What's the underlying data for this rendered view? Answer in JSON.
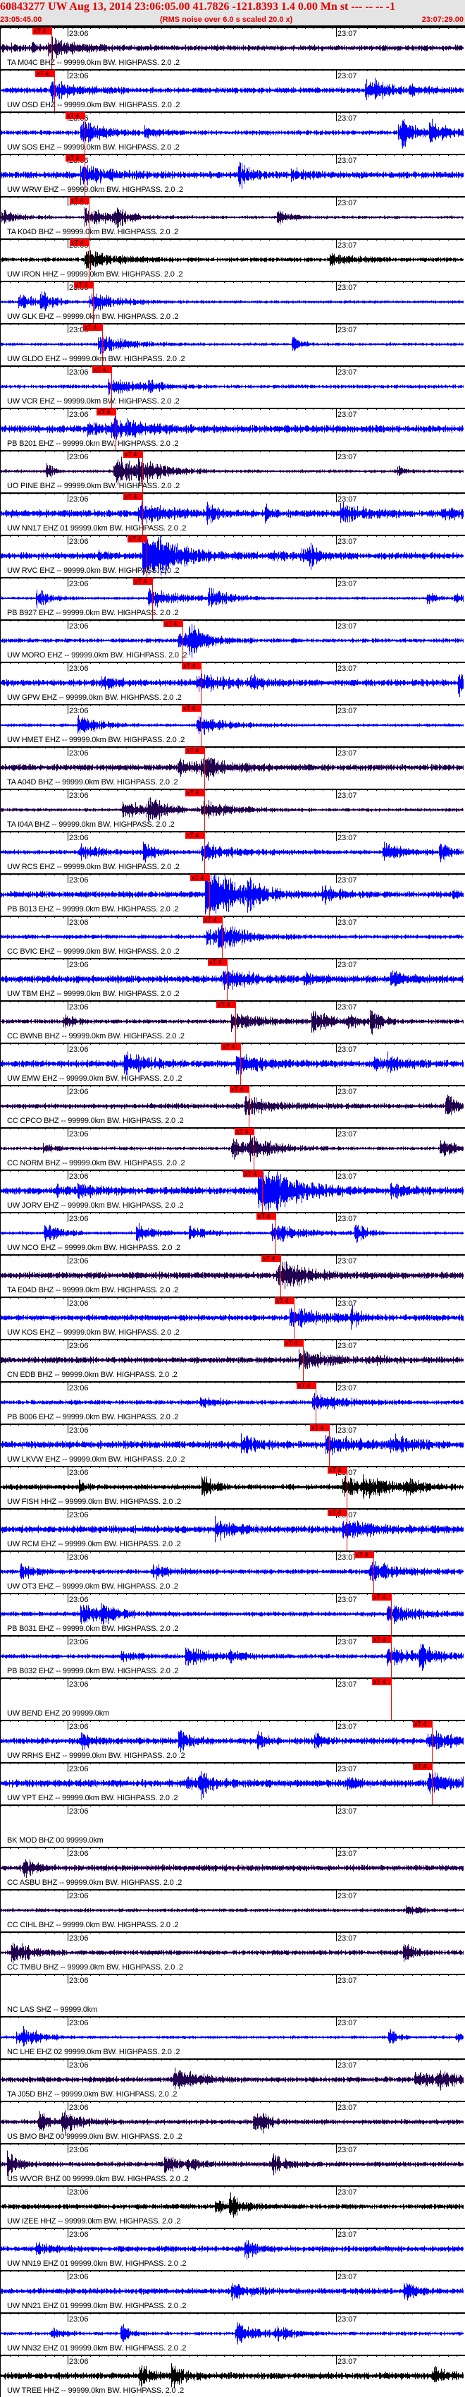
{
  "header": {
    "title": "60843277 UW Aug 13, 2014 23:06:05.00    41.7826 -121.8393  1.4 0.00 Mn st --- -- --   -1",
    "start_time": "23:05:45.00",
    "note": "(RMS noise over 6.0 s scaled 20.0 x)",
    "end_time": "23:07:29.00"
  },
  "axis": {
    "window_seconds": 104,
    "minute_labels": [
      {
        "label": "23:06",
        "t": 15
      },
      {
        "label": "23:07",
        "t": 75
      }
    ]
  },
  "pick_label": "xT 4",
  "colors": {
    "bhz": "#220050",
    "ehz": "#0000ff",
    "hhz": "#000000",
    "pick": "#ff0000",
    "header_text": "#e00000"
  },
  "traces": [
    {
      "label": "TA M04C BHZ -- 99999.0km BW. HIGHPASS. 2.0 .2",
      "color": "bhz",
      "pick_s": 11.4
    },
    {
      "label": "UW OSD EHZ -- 99999.0km BW. HIGHPASS. 2.0 .2",
      "color": "ehz",
      "pick_s": 11.9
    },
    {
      "label": "UW SOS EHZ -- 99999.0km BW. HIGHPASS. 2.0 .2",
      "color": "ehz",
      "pick_s": 18.8
    },
    {
      "label": "UW WRW EHZ -- 99999.0km BW. HIGHPASS. 2.0 .2",
      "color": "ehz",
      "pick_s": 18.8
    },
    {
      "label": "TA K04D BHZ -- 99999.0km BW. HIGHPASS. 2.0 .2",
      "color": "bhz",
      "pick_s": 19.7
    },
    {
      "label": "UW IRON HHZ -- 99999.0km BW. HIGHPASS. 2.0 .2",
      "color": "hhz",
      "pick_s": 19.7
    },
    {
      "label": "UW GLK EHZ -- 99999.0km BW. HIGHPASS. 2.0 .2",
      "color": "ehz",
      "pick_s": 20.7
    },
    {
      "label": "UW GLDO EHZ -- 99999.0km BW. HIGHPASS. 2.0 .2",
      "color": "ehz",
      "pick_s": 22.7
    },
    {
      "label": "UW VCR EHZ -- 99999.0km BW. HIGHPASS. 2.0 .2",
      "color": "ehz",
      "pick_s": 24.8
    },
    {
      "label": "PB B201 EHZ -- 99999.0km BW. HIGHPASS. 2.0 .2",
      "color": "ehz",
      "pick_s": 25.7
    },
    {
      "label": "UO PINE BHZ -- 99999.0km BW. HIGHPASS. 2.0 .2",
      "color": "bhz",
      "pick_s": 31.7
    },
    {
      "label": "UW NN17 EHZ 01 99999.0km BW. HIGHPASS. 2.0 .2",
      "color": "ehz",
      "pick_s": 31.7
    },
    {
      "label": "UW RVC EHZ -- 99999.0km BW. HIGHPASS. 2.0 .2",
      "color": "ehz",
      "pick_s": 32.6
    },
    {
      "label": "PB B927 EHZ -- 99999.0km BW. HIGHPASS. 2.0 .2",
      "color": "ehz",
      "pick_s": 33.9
    },
    {
      "label": "UW MORO EHZ -- 99999.0km BW. HIGHPASS. 2.0 .2",
      "color": "ehz",
      "pick_s": 40.6
    },
    {
      "label": "UW GPW EHZ -- 99999.0km BW. HIGHPASS. 2.0 .2",
      "color": "ehz",
      "pick_s": 44.7
    },
    {
      "label": "UW HMET EHZ -- 99999.0km BW. HIGHPASS. 2.0 .2",
      "color": "ehz",
      "pick_s": 44.7
    },
    {
      "label": "TA A04D BHZ -- 99999.0km BW. HIGHPASS. 2.0 .2",
      "color": "bhz",
      "pick_s": 45.6
    },
    {
      "label": "TA I04A BHZ -- 99999.0km BW. HIGHPASS. 2.0 .2",
      "color": "bhz",
      "pick_s": 45.6
    },
    {
      "label": "UW RCS EHZ -- 99999.0km BW. HIGHPASS. 2.0 .2",
      "color": "ehz",
      "pick_s": 45.6
    },
    {
      "label": "PB B013 EHZ -- 99999.0km BW. HIGHPASS. 2.0 .2",
      "color": "ehz",
      "pick_s": 46.6
    },
    {
      "label": "CC BVIC EHZ -- 99999.0km BW. HIGHPASS. 2.0 .2",
      "color": "ehz",
      "pick_s": 49.5
    },
    {
      "label": "UW TBM EHZ -- 99999.0km BW. HIGHPASS. 2.0 .2",
      "color": "ehz",
      "pick_s": 50.6
    },
    {
      "label": "CC BWNB BHZ -- 99999.0km BW. HIGHPASS. 2.0 .2",
      "color": "bhz",
      "pick_s": 52.5
    },
    {
      "label": "UW EMW EHZ -- 99999.0km BW. HIGHPASS. 2.0 .2",
      "color": "ehz",
      "pick_s": 53.6
    },
    {
      "label": "CC CPCO BHZ -- 99999.0km BW. HIGHPASS. 2.0 .2",
      "color": "bhz",
      "pick_s": 55.5
    },
    {
      "label": "CC NORM BHZ -- 99999.0km BW. HIGHPASS. 2.0 .2",
      "color": "bhz",
      "pick_s": 56.6
    },
    {
      "label": "UW JORV EHZ -- 99999.0km BW. HIGHPASS. 2.0 .2",
      "color": "ehz",
      "pick_s": 58.5
    },
    {
      "label": "UW NCO EHZ -- 99999.0km BW. HIGHPASS. 2.0 .2",
      "color": "ehz",
      "pick_s": 61.4
    },
    {
      "label": "TA E04D BHZ -- 99999.0km BW. HIGHPASS. 2.0 .2",
      "color": "bhz",
      "pick_s": 62.5
    },
    {
      "label": "UW KOS EHZ -- 99999.0km BW. HIGHPASS. 2.0 .2",
      "color": "ehz",
      "pick_s": 65.5
    },
    {
      "label": "CN EDB BHZ -- 99999.0km BW. HIGHPASS. 2.0 .2",
      "color": "bhz",
      "pick_s": 67.6
    },
    {
      "label": "PB B006 EHZ -- 99999.0km BW. HIGHPASS. 2.0 .2",
      "color": "ehz",
      "pick_s": 70.5
    },
    {
      "label": "UW LKVW EHZ -- 99999.0km BW. HIGHPASS. 2.0 .2",
      "color": "ehz",
      "pick_s": 73.5
    },
    {
      "label": "UW FISH HHZ -- 99999.0km BW. HIGHPASS. 2.0 .2",
      "color": "hhz",
      "pick_s": 77.4
    },
    {
      "label": "UW RCM EHZ -- 99999.0km BW. HIGHPASS. 2.0 .2",
      "color": "ehz",
      "pick_s": 77.4
    },
    {
      "label": "UW OT3 EHZ -- 99999.0km BW. HIGHPASS. 2.0 .2",
      "color": "ehz",
      "pick_s": 83.4
    },
    {
      "label": "PB B031 EHZ -- 99999.0km BW. HIGHPASS. 2.0 .2",
      "color": "ehz",
      "pick_s": 87.3
    },
    {
      "label": "PB B032 EHZ -- 99999.0km BW. HIGHPASS. 2.0 .2",
      "color": "ehz",
      "pick_s": 87.3
    },
    {
      "label": "UW BEND EHZ 20 99999.0km",
      "color": "ehz",
      "pick_s": 87.3,
      "no_data": true
    },
    {
      "label": "UW RRHS EHZ -- 99999.0km BW. HIGHPASS. 2.0 .2",
      "color": "ehz",
      "pick_s": 96.4
    },
    {
      "label": "UW YPT EHZ -- 99999.0km BW. HIGHPASS. 2.0 .2",
      "color": "ehz",
      "pick_s": 96.4
    },
    {
      "label": "BK MOD BHZ 00 99999.0km",
      "color": "bhz",
      "no_data": true
    },
    {
      "label": "CC ASBU BHZ -- 99999.0km BW. HIGHPASS. 2.0 .2",
      "color": "bhz"
    },
    {
      "label": "CC CIHL BHZ -- 99999.0km BW. HIGHPASS. 2.0 .2",
      "color": "bhz"
    },
    {
      "label": "CC TMBU BHZ -- 99999.0km BW. HIGHPASS. 2.0 .2",
      "color": "bhz"
    },
    {
      "label": "NC LAS SHZ -- 99999.0km",
      "color": "ehz",
      "no_data": true
    },
    {
      "label": "NC LHE EHZ 02 99999.0km BW. HIGHPASS. 2.0 .2",
      "color": "ehz"
    },
    {
      "label": "TA J05D BHZ -- 99999.0km BW. HIGHPASS. 2.0 .2",
      "color": "bhz"
    },
    {
      "label": "US BMO BHZ 00 99999.0km BW. HIGHPASS. 2.0 .2",
      "color": "bhz"
    },
    {
      "label": "US WVOR BHZ 00 99999.0km BW. HIGHPASS. 2.0 .2",
      "color": "bhz"
    },
    {
      "label": "UW IZEE HHZ -- 99999.0km BW. HIGHPASS. 2.0 .2",
      "color": "hhz"
    },
    {
      "label": "UW NN19 EHZ 01 99999.0km BW. HIGHPASS. 2.0 .2",
      "color": "ehz"
    },
    {
      "label": "UW NN21 EHZ 01 99999.0km BW. HIGHPASS. 2.0 .2",
      "color": "ehz"
    },
    {
      "label": "UW NN32 EHZ 01 99999.0km BW. HIGHPASS. 2.0 .2",
      "color": "ehz"
    },
    {
      "label": "UW TREE HHZ -- 99999.0km BW. HIGHPASS. 2.0 .2",
      "color": "hhz"
    }
  ]
}
